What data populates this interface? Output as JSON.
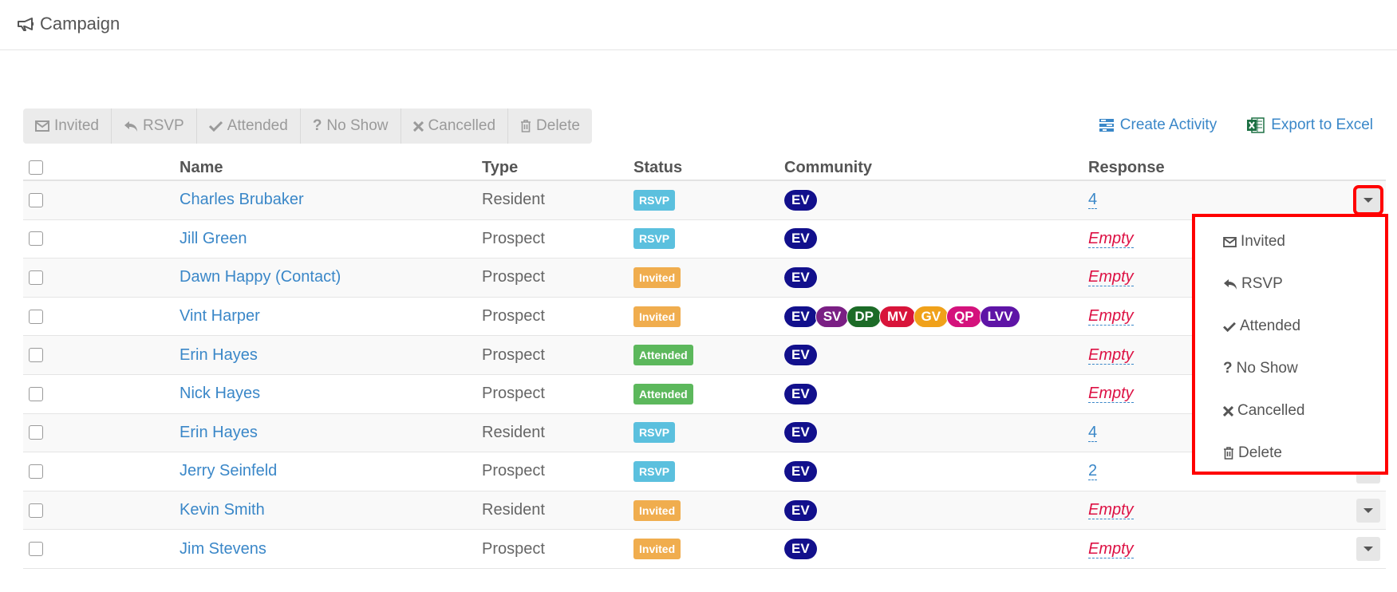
{
  "header": {
    "title": "Campaign",
    "icon": "bullhorn-icon"
  },
  "toolbar": {
    "buttons": [
      {
        "label": "Invited",
        "icon": "envelope-icon"
      },
      {
        "label": "RSVP",
        "icon": "reply-icon"
      },
      {
        "label": "Attended",
        "icon": "check-icon"
      },
      {
        "label": "No Show",
        "icon": "question-icon"
      },
      {
        "label": "Cancelled",
        "icon": "times-icon"
      },
      {
        "label": "Delete",
        "icon": "trash-icon"
      }
    ]
  },
  "actions": {
    "create_activity": "Create Activity",
    "export_excel": "Export to Excel"
  },
  "table": {
    "headers": {
      "name": "Name",
      "type": "Type",
      "status": "Status",
      "community": "Community",
      "response": "Response"
    },
    "rows": [
      {
        "name": "Charles Brubaker",
        "type": "Resident",
        "status": "RSVP",
        "communities": [
          "EV"
        ],
        "response": "4"
      },
      {
        "name": "Jill Green",
        "type": "Prospect",
        "status": "RSVP",
        "communities": [
          "EV"
        ],
        "response": "Empty"
      },
      {
        "name": "Dawn Happy (Contact)",
        "type": "Prospect",
        "status": "Invited",
        "communities": [
          "EV"
        ],
        "response": "Empty"
      },
      {
        "name": "Vint Harper",
        "type": "Prospect",
        "status": "Invited",
        "communities": [
          "EV",
          "SV",
          "DP",
          "MV",
          "GV",
          "QP",
          "LVV"
        ],
        "response": "Empty"
      },
      {
        "name": "Erin Hayes",
        "type": "Prospect",
        "status": "Attended",
        "communities": [
          "EV"
        ],
        "response": "Empty"
      },
      {
        "name": "Nick Hayes",
        "type": "Prospect",
        "status": "Attended",
        "communities": [
          "EV"
        ],
        "response": "Empty"
      },
      {
        "name": "Erin Hayes",
        "type": "Resident",
        "status": "RSVP",
        "communities": [
          "EV"
        ],
        "response": "4"
      },
      {
        "name": "Jerry Seinfeld",
        "type": "Prospect",
        "status": "RSVP",
        "communities": [
          "EV"
        ],
        "response": "2"
      },
      {
        "name": "Kevin Smith",
        "type": "Resident",
        "status": "Invited",
        "communities": [
          "EV"
        ],
        "response": "Empty"
      },
      {
        "name": "Jim Stevens",
        "type": "Prospect",
        "status": "Invited",
        "communities": [
          "EV"
        ],
        "response": "Empty"
      }
    ]
  },
  "community_colors": {
    "EV": "#12108c",
    "SV": "#7a1f84",
    "DP": "#1c6b27",
    "MV": "#d8143a",
    "GV": "#f0a11a",
    "QP": "#d4127c",
    "LVV": "#5e14a6"
  },
  "status_colors": {
    "RSVP": "#5bc0de",
    "Invited": "#f0ad4e",
    "Attended": "#5cb85c"
  },
  "dropdown": {
    "items": [
      {
        "label": "Invited",
        "icon": "envelope-icon"
      },
      {
        "label": "RSVP",
        "icon": "reply-icon"
      },
      {
        "label": "Attended",
        "icon": "check-icon"
      },
      {
        "label": "No Show",
        "icon": "question-icon"
      },
      {
        "label": "Cancelled",
        "icon": "times-icon"
      },
      {
        "label": "Delete",
        "icon": "trash-icon"
      }
    ]
  }
}
